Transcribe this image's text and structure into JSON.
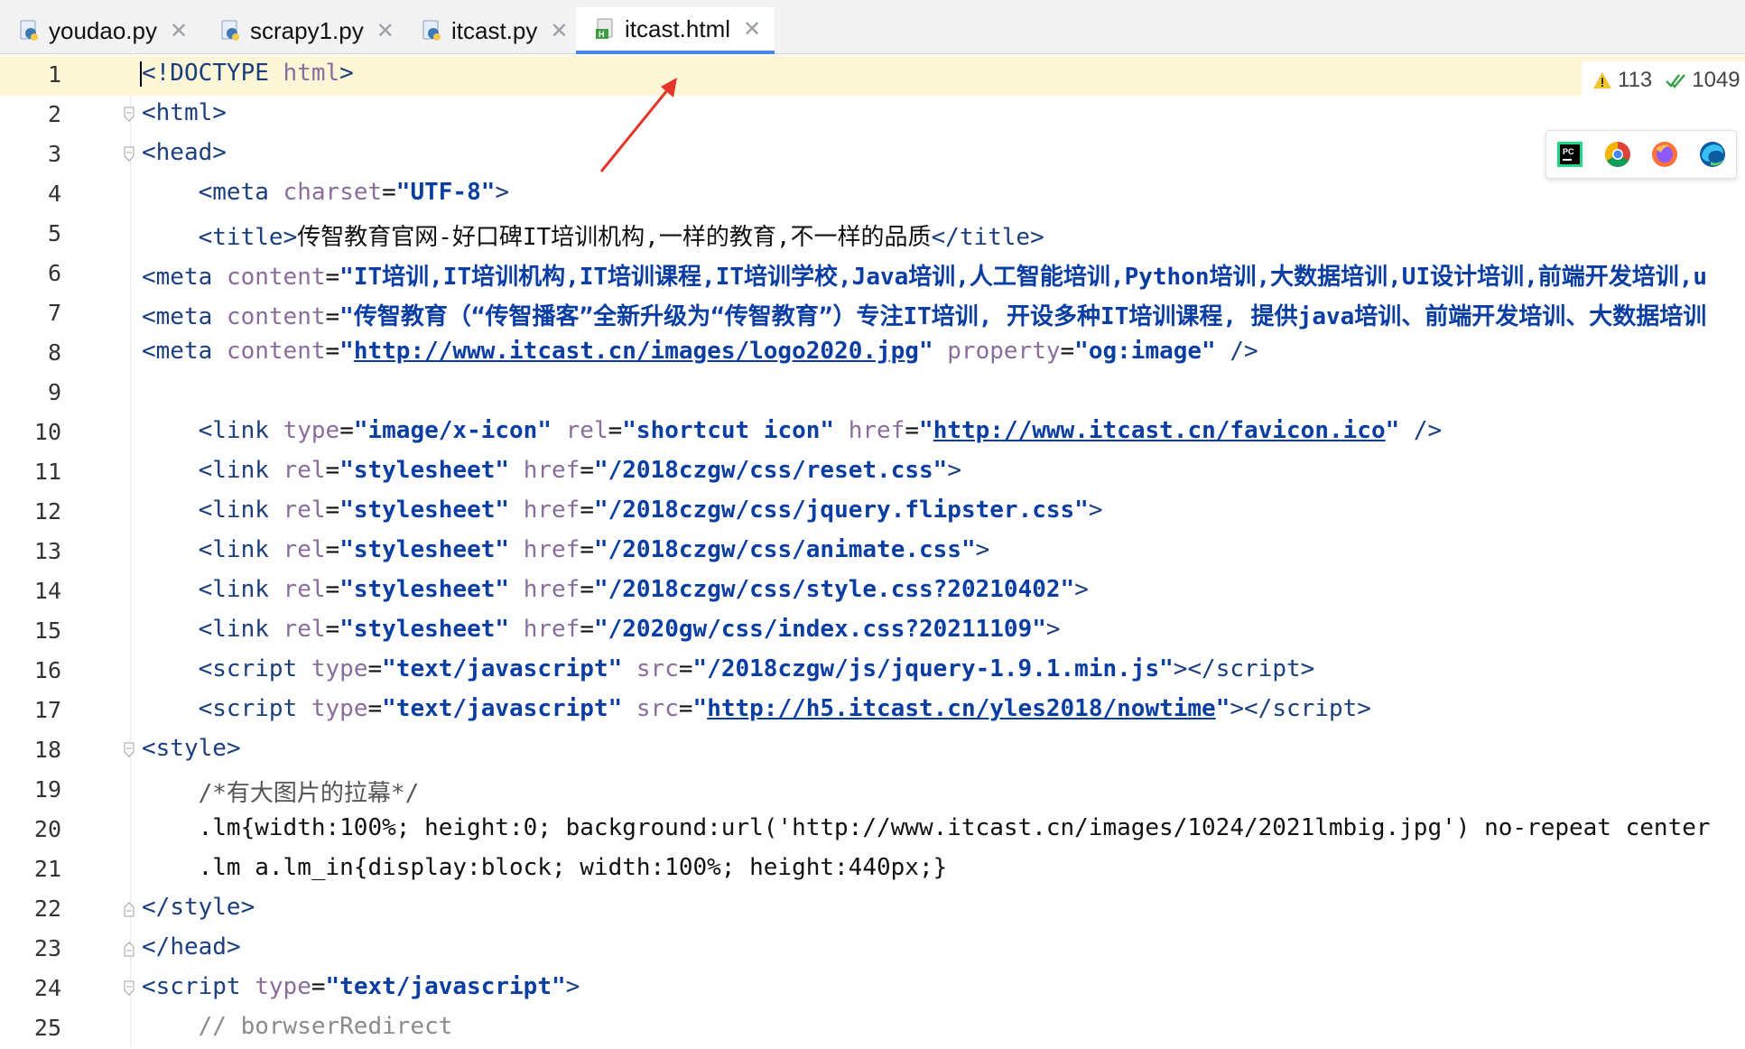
{
  "tabs": [
    {
      "label": "youdao.py",
      "type": "python",
      "active": false
    },
    {
      "label": "scrapy1.py",
      "type": "python",
      "active": false
    },
    {
      "label": "itcast.py",
      "type": "python",
      "active": false
    },
    {
      "label": "itcast.html",
      "type": "html",
      "active": true
    }
  ],
  "inspection": {
    "warnings": "113",
    "ok": "1049"
  },
  "browsers": [
    "pycharm-icon",
    "chrome-icon",
    "firefox-icon",
    "edge-icon"
  ],
  "lines": [
    {
      "n": "1"
    },
    {
      "n": "2"
    },
    {
      "n": "3"
    },
    {
      "n": "4"
    },
    {
      "n": "5"
    },
    {
      "n": "6"
    },
    {
      "n": "7"
    },
    {
      "n": "8"
    },
    {
      "n": "9"
    },
    {
      "n": "10"
    },
    {
      "n": "11"
    },
    {
      "n": "12"
    },
    {
      "n": "13"
    },
    {
      "n": "14"
    },
    {
      "n": "15"
    },
    {
      "n": "16"
    },
    {
      "n": "17"
    },
    {
      "n": "18"
    },
    {
      "n": "19"
    },
    {
      "n": "20"
    },
    {
      "n": "21"
    },
    {
      "n": "22"
    },
    {
      "n": "23"
    },
    {
      "n": "24"
    },
    {
      "n": "25"
    }
  ],
  "code": {
    "l1": {
      "a": "<!DOCTYPE",
      "b": " html",
      "c": ">"
    },
    "l2": {
      "a": "<",
      "b": "html",
      "c": ">"
    },
    "l3": {
      "a": "<",
      "b": "head",
      "c": ">"
    },
    "l4": {
      "indent": "    ",
      "a": "<",
      "b": "meta",
      "sp": " ",
      "attr": "charset",
      "eq": "=",
      "val": "\"UTF-8\"",
      "c": ">"
    },
    "l5": {
      "indent": "    ",
      "a": "<",
      "b": "title",
      "c": ">",
      "text": "传智教育官网-好口碑IT培训机构,一样的教育,不一样的品质",
      "d": "</",
      "e": "title",
      "f": ">"
    },
    "l6": {
      "a": "<",
      "b": "meta",
      "sp": " ",
      "attr": "content",
      "eq": "=",
      "val": "\"IT培训,IT培训机构,IT培训课程,IT培训学校,Java培训,人工智能培训,Python培训,大数据培训,UI设计培训,前端开发培训,u"
    },
    "l7": {
      "a": "<",
      "b": "meta",
      "sp": " ",
      "attr": "content",
      "eq": "=",
      "val": "\"传智教育（“传智播客”全新升级为“传智教育”）专注IT培训, 开设多种IT培训课程, 提供java培训、前端开发培训、大数据培训"
    },
    "l8": {
      "a": "<",
      "b": "meta",
      "sp": " ",
      "attr": "content",
      "eq": "=",
      "q1": "\"",
      "url": "http://www.itcast.cn/images/logo2020.jpg",
      "q2": "\"",
      "sp2": " ",
      "attr2": "property",
      "eq2": "=",
      "val2": "\"og:image\"",
      "end": " />"
    },
    "l10": {
      "indent": "    ",
      "a": "<",
      "b": "link",
      "sp": " ",
      "attr": "type",
      "eq": "=",
      "val": "\"image/x-icon\"",
      "sp2": " ",
      "attr2": "rel",
      "eq2": "=",
      "val2": "\"shortcut icon\"",
      "sp3": " ",
      "attr3": "href",
      "eq3": "=",
      "q1": "\"",
      "url": "http://www.itcast.cn/favicon.ico",
      "q2": "\"",
      "end": " />"
    },
    "l11": {
      "indent": "    ",
      "a": "<",
      "b": "link",
      "sp": " ",
      "attr": "rel",
      "eq": "=",
      "val": "\"stylesheet\"",
      "sp2": " ",
      "attr2": "href",
      "eq2": "=",
      "val2": "\"/2018czgw/css/reset.css\"",
      "c": ">"
    },
    "l12": {
      "indent": "    ",
      "a": "<",
      "b": "link",
      "sp": " ",
      "attr": "rel",
      "eq": "=",
      "val": "\"stylesheet\"",
      "sp2": " ",
      "attr2": "href",
      "eq2": "=",
      "val2": "\"/2018czgw/css/jquery.flipster.css\"",
      "c": ">"
    },
    "l13": {
      "indent": "    ",
      "a": "<",
      "b": "link",
      "sp": " ",
      "attr": "rel",
      "eq": "=",
      "val": "\"stylesheet\"",
      "sp2": " ",
      "attr2": "href",
      "eq2": "=",
      "val2": "\"/2018czgw/css/animate.css\"",
      "c": ">"
    },
    "l14": {
      "indent": "    ",
      "a": "<",
      "b": "link",
      "sp": " ",
      "attr": "rel",
      "eq": "=",
      "val": "\"stylesheet\"",
      "sp2": " ",
      "attr2": "href",
      "eq2": "=",
      "val2": "\"/2018czgw/css/style.css?20210402\"",
      "c": ">"
    },
    "l15": {
      "indent": "    ",
      "a": "<",
      "b": "link",
      "sp": " ",
      "attr": "rel",
      "eq": "=",
      "val": "\"stylesheet\"",
      "sp2": " ",
      "attr2": "href",
      "eq2": "=",
      "val2": "\"/2020gw/css/index.css?20211109\"",
      "c": ">"
    },
    "l16": {
      "indent": "    ",
      "a": "<",
      "b": "script",
      "sp": " ",
      "attr": "type",
      "eq": "=",
      "val": "\"text/javascript\"",
      "sp2": " ",
      "attr2": "src",
      "eq2": "=",
      "val2": "\"/2018czgw/js/jquery-1.9.1.min.js\"",
      "c": "></",
      "e": "script",
      "f": ">"
    },
    "l17": {
      "indent": "    ",
      "a": "<",
      "b": "script",
      "sp": " ",
      "attr": "type",
      "eq": "=",
      "val": "\"text/javascript\"",
      "sp2": " ",
      "attr2": "src",
      "eq2": "=",
      "q1": "\"",
      "url": "http://h5.itcast.cn/yles2018/nowtime",
      "q2": "\"",
      "c": "></",
      "e": "script",
      "f": ">"
    },
    "l18": {
      "a": "<",
      "b": "style",
      "c": ">"
    },
    "l19": {
      "indent": "    ",
      "text": "/*有大图片的拉幕*/"
    },
    "l20": {
      "indent": "    ",
      "text": ".lm{width:100%; height:0; background:url('http://www.itcast.cn/images/1024/2021lmbig.jpg') no-repeat center"
    },
    "l21": {
      "indent": "    ",
      "text": ".lm a.lm_in{display:block; width:100%; height:440px;}"
    },
    "l22": {
      "a": "</",
      "b": "style",
      "c": ">"
    },
    "l23": {
      "a": "</",
      "b": "head",
      "c": ">"
    },
    "l24": {
      "a": "<",
      "b": "script",
      "sp": " ",
      "attr": "type",
      "eq": "=",
      "val": "\"text/javascript\"",
      "c": ">"
    },
    "l25": {
      "indent": "    ",
      "text": "// borwserRedirect"
    }
  }
}
